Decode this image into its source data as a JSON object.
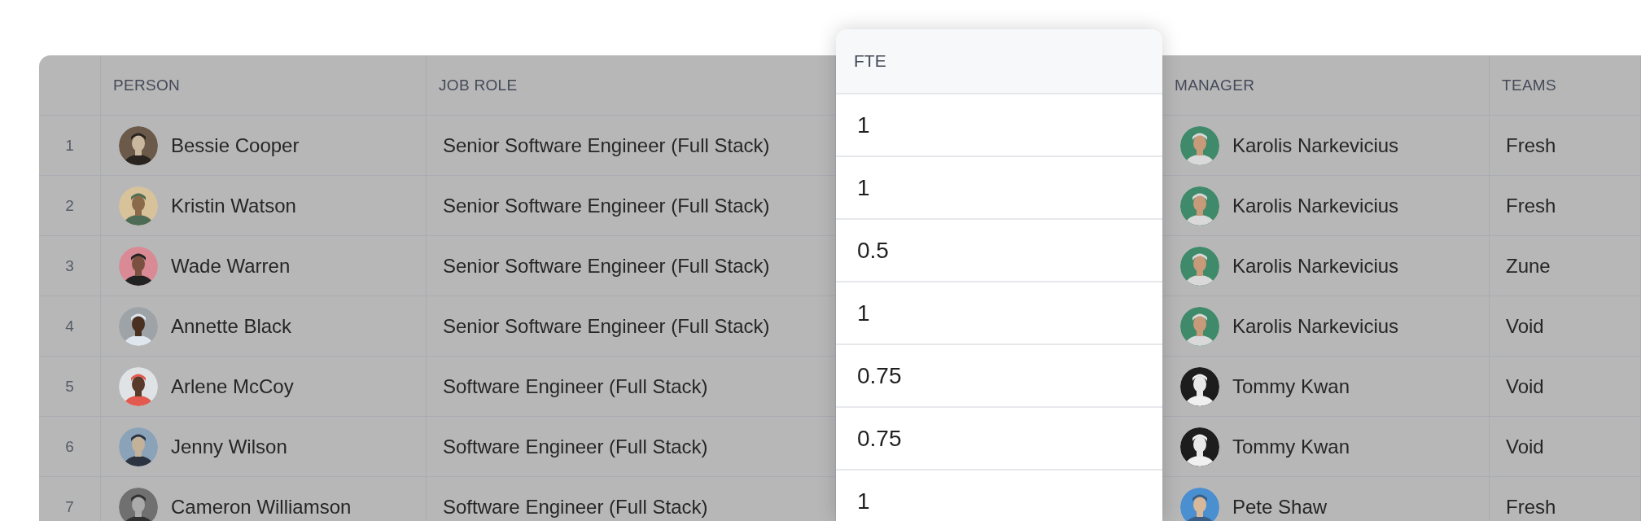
{
  "table": {
    "columns": [
      {
        "label": "PERSON"
      },
      {
        "label": "JOB ROLE"
      },
      {
        "label": "MANAGER"
      },
      {
        "label": "TEAMS"
      }
    ],
    "dragged_column": {
      "label": "FTE"
    },
    "rows": [
      {
        "index": "1",
        "person": "Bessie Cooper",
        "job_role": "Senior Software Engineer (Full Stack)",
        "fte": "1",
        "manager": "Karolis Narkevicius",
        "team": "Fresh"
      },
      {
        "index": "2",
        "person": "Kristin Watson",
        "job_role": "Senior Software Engineer (Full Stack)",
        "fte": "1",
        "manager": "Karolis Narkevicius",
        "team": "Fresh"
      },
      {
        "index": "3",
        "person": "Wade Warren",
        "job_role": "Senior Software Engineer (Full Stack)",
        "fte": "0.5",
        "manager": "Karolis Narkevicius",
        "team": "Zune"
      },
      {
        "index": "4",
        "person": "Annette Black",
        "job_role": "Senior Software Engineer (Full Stack)",
        "fte": "1",
        "manager": "Karolis Narkevicius",
        "team": "Void"
      },
      {
        "index": "5",
        "person": "Arlene McCoy",
        "job_role": "Software Engineer (Full Stack)",
        "fte": "0.75",
        "manager": "Tommy Kwan",
        "team": "Void"
      },
      {
        "index": "6",
        "person": "Jenny Wilson",
        "job_role": "Software Engineer (Full Stack)",
        "fte": "0.75",
        "manager": "Tommy Kwan",
        "team": "Void"
      },
      {
        "index": "7",
        "person": "Cameron Williamson",
        "job_role": "Software Engineer (Full Stack)",
        "fte": "1",
        "manager": "Pete Shaw",
        "team": "Fresh"
      }
    ]
  }
}
